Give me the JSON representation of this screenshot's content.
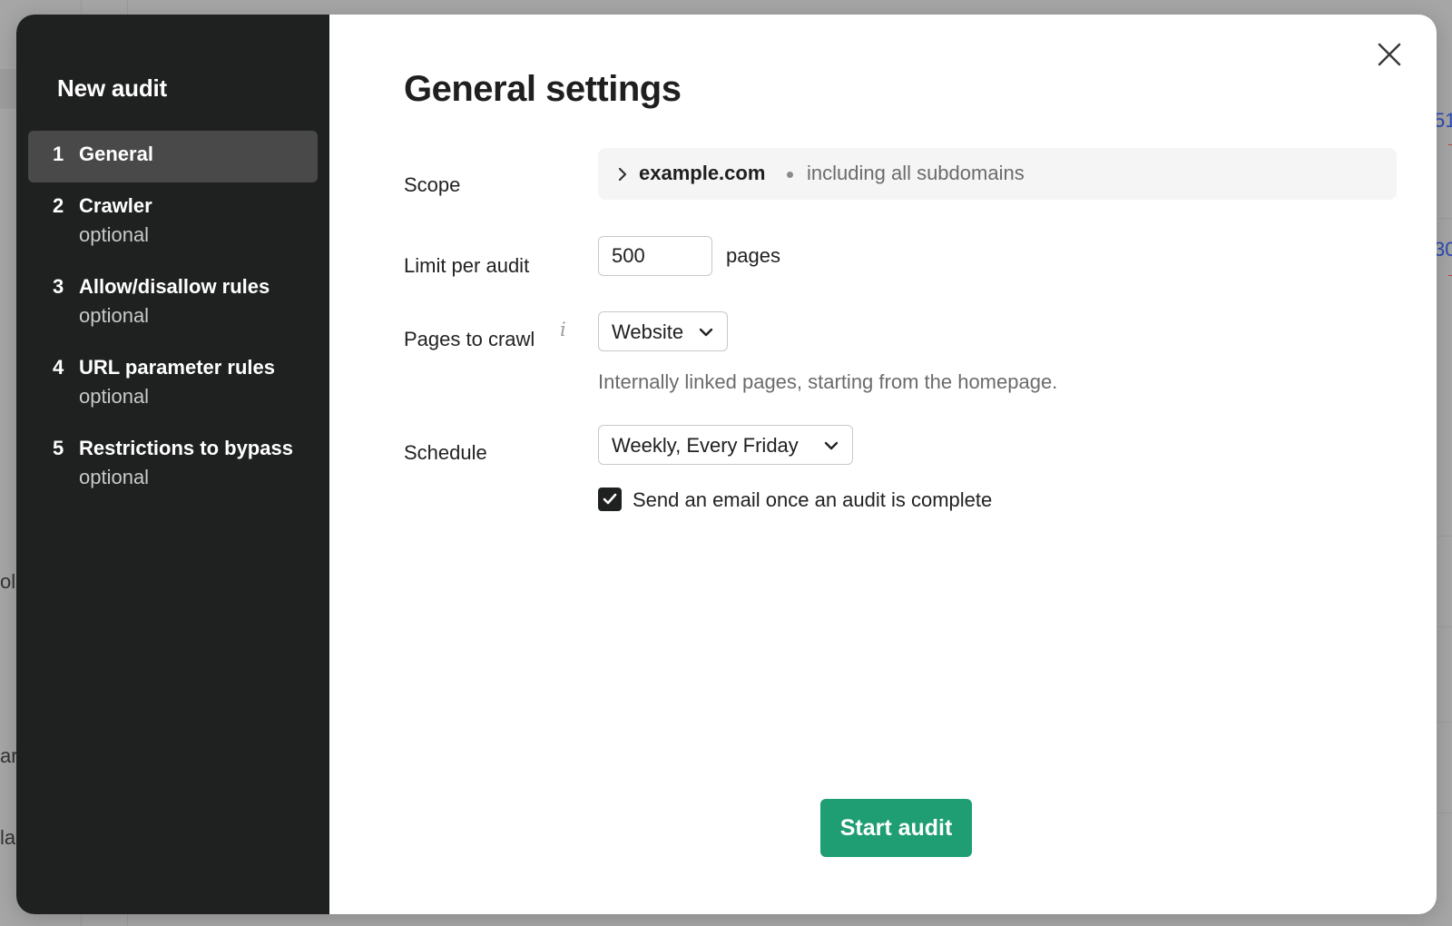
{
  "sidebar": {
    "title": "New audit",
    "steps": [
      {
        "num": "1",
        "label": "General",
        "sub": "",
        "active": true
      },
      {
        "num": "2",
        "label": "Crawler",
        "sub": "optional"
      },
      {
        "num": "3",
        "label": "Allow/disallow rules",
        "sub": "optional"
      },
      {
        "num": "4",
        "label": "URL parameter rules",
        "sub": "optional"
      },
      {
        "num": "5",
        "label": "Restrictions to bypass",
        "sub": "optional"
      }
    ]
  },
  "main": {
    "title": "General settings",
    "scope": {
      "label": "Scope",
      "domain": "example.com",
      "subtitle": "including all subdomains"
    },
    "limit": {
      "label": "Limit per audit",
      "value": "500",
      "suffix": "pages"
    },
    "pages_to_crawl": {
      "label": "Pages to crawl",
      "info_icon": "i",
      "selected": "Website",
      "hint": "Internally linked pages, starting from the homepage."
    },
    "schedule": {
      "label": "Schedule",
      "selected": "Weekly, Every Friday"
    },
    "email_checkbox": {
      "label": "Send an email once an audit is complete",
      "checked": true
    },
    "start_button": "Start audit"
  },
  "background_fragments": {
    "right_top": "51",
    "right_mid": "30",
    "left_1": "ol",
    "left_2": "ar",
    "left_3": "la"
  },
  "colors": {
    "sidebar_bg": "#1f2120",
    "active_step_bg": "#484948",
    "primary": "#1e9e72"
  }
}
